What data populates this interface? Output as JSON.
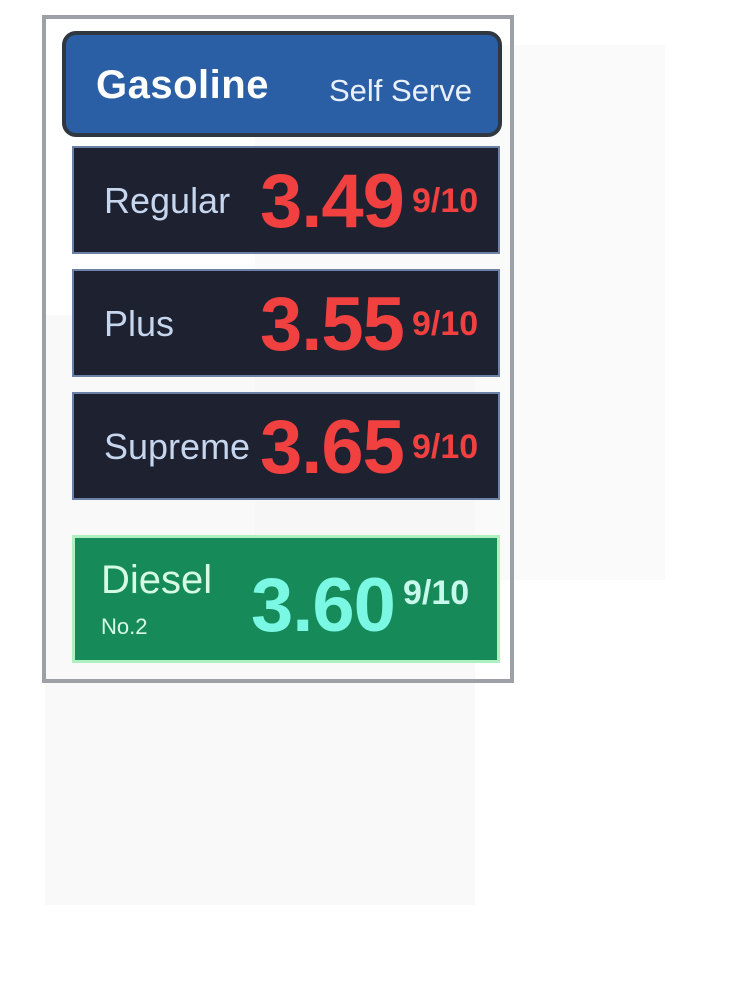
{
  "sign": {
    "title": "Gasoline",
    "subtitle": "Self Serve",
    "grades": [
      {
        "label": "Regular",
        "price": "3.49",
        "fraction": "9/10"
      },
      {
        "label": "Plus",
        "price": "3.55",
        "fraction": "9/10"
      },
      {
        "label": "Supreme",
        "price": "3.65",
        "fraction": "9/10"
      }
    ],
    "diesel": {
      "label": "Diesel",
      "sublabel": "No.2",
      "price": "3.60",
      "fraction": "9/10"
    }
  },
  "colors": {
    "header_bg": "#2a5fa6",
    "grade_bg": "#1d2130",
    "grade_price": "#f04040",
    "diesel_bg": "#178a5a",
    "diesel_price": "#7af8e4"
  }
}
